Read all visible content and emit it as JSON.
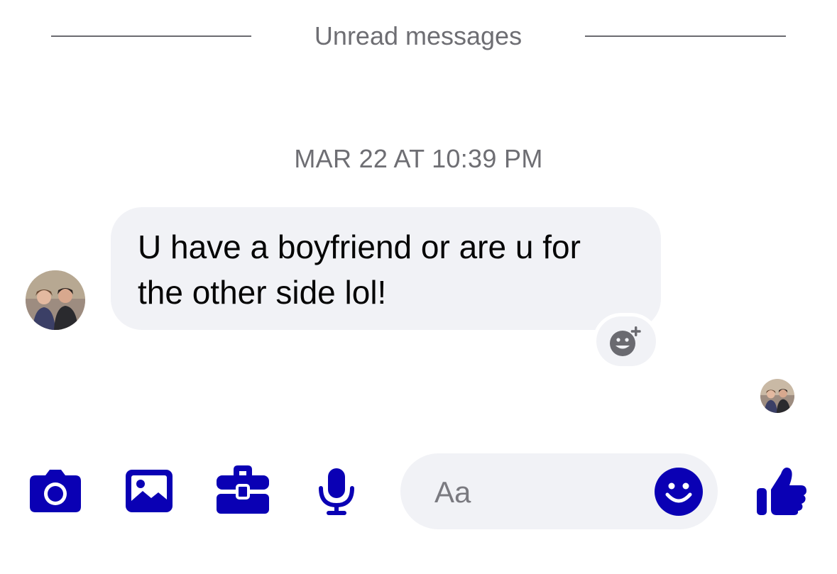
{
  "divider": {
    "label": "Unread messages"
  },
  "thread": {
    "timestamp": "MAR 22 AT 10:39 PM",
    "messages": [
      {
        "text": "U have a boyfriend or are u for the other side lol!"
      }
    ]
  },
  "composer": {
    "placeholder": "Aa"
  },
  "icons": {
    "camera": "camera-icon",
    "gallery": "image-icon",
    "games": "briefcase-icon",
    "mic": "microphone-icon",
    "emoji": "smiley-icon",
    "like": "thumbs-up-icon",
    "reaction": "add-reaction-icon"
  },
  "colors": {
    "accent": "#0a00b4",
    "bubble": "#f1f2f6",
    "muted_text": "#6e6e73"
  }
}
